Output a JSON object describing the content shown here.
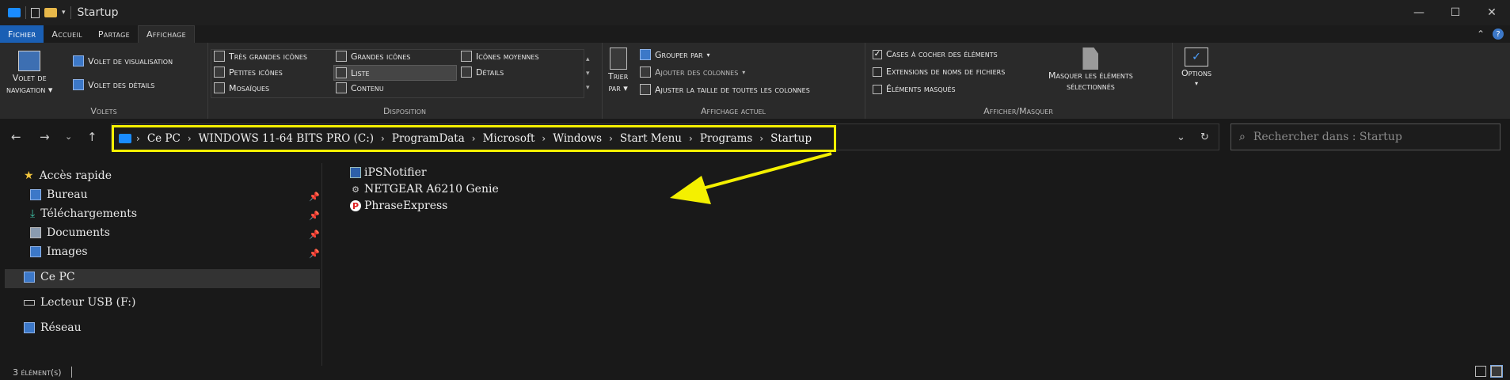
{
  "window": {
    "title": "Startup",
    "minimize": "—",
    "maximize": "☐",
    "close": "✕"
  },
  "tabs": [
    "Fichier",
    "Accueil",
    "Partage",
    "Affichage"
  ],
  "active_tab": "Affichage",
  "ribbon": {
    "volets": {
      "label": "Volets",
      "nav_pane_line1": "Volet de",
      "nav_pane_line2": "navigation",
      "preview_pane": "Volet de visualisation",
      "details_pane": "Volet des détails"
    },
    "disposition": {
      "label": "Disposition",
      "items": [
        "Très grandes icônes",
        "Grandes icônes",
        "Icônes moyennes",
        "Petites icônes",
        "Liste",
        "Détails",
        "Mosaïques",
        "Contenu"
      ],
      "selected": "Liste"
    },
    "affichage_actuel": {
      "label": "Affichage actuel",
      "sort_line1": "Trier",
      "sort_line2": "par",
      "group_by": "Grouper par",
      "add_columns": "Ajouter des colonnes",
      "fit_columns": "Ajuster la taille de toutes les colonnes"
    },
    "afficher_masquer": {
      "label": "Afficher/Masquer",
      "item_checkboxes": "Cases à cocher des éléments",
      "item_checkboxes_checked": true,
      "file_extensions": "Extensions de noms de fichiers",
      "file_extensions_checked": false,
      "hidden_items": "Éléments masqués",
      "hidden_items_checked": false,
      "hide_selected_line1": "Masquer les éléments",
      "hide_selected_line2": "sélectionnés"
    },
    "options": {
      "label": "Options"
    }
  },
  "address": {
    "crumbs": [
      "Ce PC",
      "WINDOWS 11-64 BITS PRO (C:)",
      "ProgramData",
      "Microsoft",
      "Windows",
      "Start Menu",
      "Programs",
      "Startup"
    ],
    "search_placeholder": "Rechercher dans : Startup"
  },
  "sidebar": {
    "quick_access": "Accès rapide",
    "pinned": [
      "Bureau",
      "Téléchargements",
      "Documents",
      "Images"
    ],
    "this_pc": "Ce PC",
    "usb": "Lecteur USB (F:)",
    "network": "Réseau"
  },
  "files": [
    "iPSNotifier",
    "NETGEAR A6210 Genie",
    "PhraseExpress"
  ],
  "status": {
    "count": "3 élément(s)"
  },
  "colors": {
    "accent": "#1a5fb4",
    "highlight": "#f4f000",
    "folder": "#1a8cff"
  }
}
